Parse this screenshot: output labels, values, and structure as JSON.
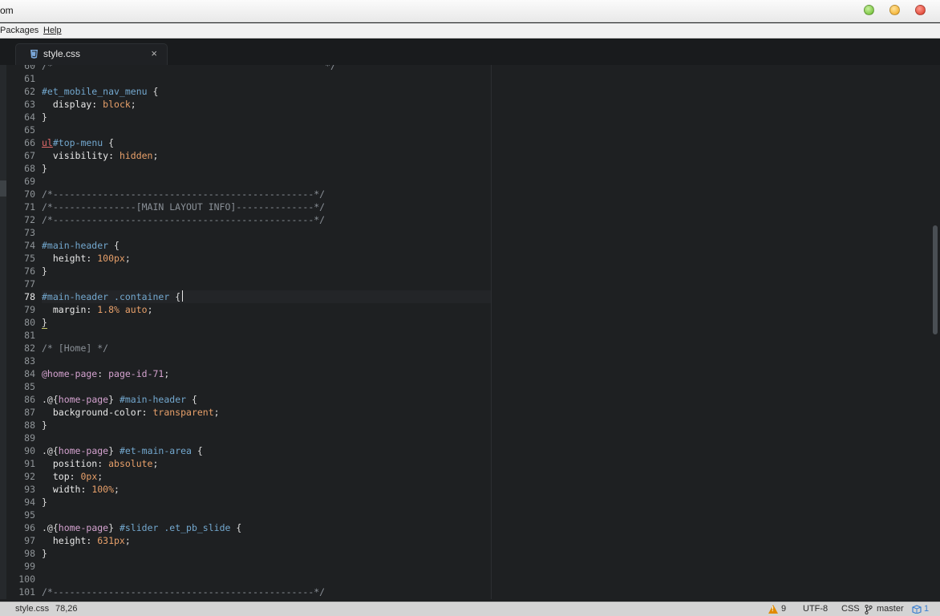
{
  "window": {
    "title": "om"
  },
  "menu": {
    "items": [
      "Packages",
      "Help"
    ]
  },
  "tab": {
    "label": "style.css",
    "close": "×"
  },
  "gutter": {
    "line_numbers": [
      "60",
      "61",
      "62",
      "63",
      "64",
      "65",
      "66",
      "67",
      "68",
      "69",
      "70",
      "71",
      "72",
      "73",
      "74",
      "75",
      "76",
      "77",
      "78",
      "79",
      "80",
      "81",
      "82",
      "83",
      "84",
      "85",
      "86",
      "87",
      "88",
      "89",
      "90",
      "91",
      "92",
      "93",
      "94",
      "95",
      "96",
      "97",
      "98",
      "99",
      "100",
      "101"
    ],
    "active_line": "78"
  },
  "code": {
    "l60": "/*                                                 */",
    "l62a": "#et_mobile_nav_menu",
    "l62b": " {",
    "l63a": "  display:",
    "l63b": " block",
    "l63c": ";",
    "l64": "}",
    "l66a": "ul",
    "l66b": "#top-menu",
    "l66c": " {",
    "l67a": "  visibility:",
    "l67b": " hidden",
    "l67c": ";",
    "l68": "}",
    "l70": "/*-----------------------------------------------*/",
    "l71": "/*---------------[MAIN LAYOUT INFO]--------------*/",
    "l72": "/*-----------------------------------------------*/",
    "l74a": "#main-header",
    "l74b": " {",
    "l75a": "  height:",
    "l75b": " 100px",
    "l75c": ";",
    "l76": "}",
    "l78a": "#main-header",
    "l78b": " .container",
    "l78c": " {",
    "l79a": "  margin:",
    "l79b": " 1.8% auto",
    "l79c": ";",
    "l80": "}",
    "l82": "/* [Home] */",
    "l84a": "@home-page",
    "l84b": ":",
    "l84c": " page-id-71",
    "l84d": ";",
    "l86a": ".@{",
    "l86b": "home-page",
    "l86c": "}",
    "l86d": " #main-header",
    "l86e": " {",
    "l87a": "  background-color:",
    "l87b": " transparent",
    "l87c": ";",
    "l88": "}",
    "l90a": ".@{",
    "l90b": "home-page",
    "l90c": "}",
    "l90d": " #et-main-area",
    "l90e": " {",
    "l91a": "  position:",
    "l91b": " absolute",
    "l91c": ";",
    "l92a": "  top:",
    "l92b": " 0px",
    "l92c": ";",
    "l93a": "  width:",
    "l93b": " 100%",
    "l93c": ";",
    "l94": "}",
    "l96a": ".@{",
    "l96b": "home-page",
    "l96c": "}",
    "l96d": " #slider",
    "l96e": " .et_pb_slide",
    "l96f": " {",
    "l97a": "  height:",
    "l97b": " 631px",
    "l97c": ";",
    "l98": "}",
    "l101": "/*-----------------------------------------------*/"
  },
  "status": {
    "file": "style.css",
    "cursor": "78,26",
    "warnings": "9",
    "encoding": "UTF-8",
    "grammar": "CSS",
    "branch": "master",
    "packages": "1"
  },
  "colors": {
    "editor_bg": "#1e2022",
    "selector": "#73a8cf",
    "value": "#e8a06a",
    "comment": "#8a9097",
    "variable": "#d4a2cf",
    "tag": "#e06a6a",
    "warning": "#e08a00"
  }
}
